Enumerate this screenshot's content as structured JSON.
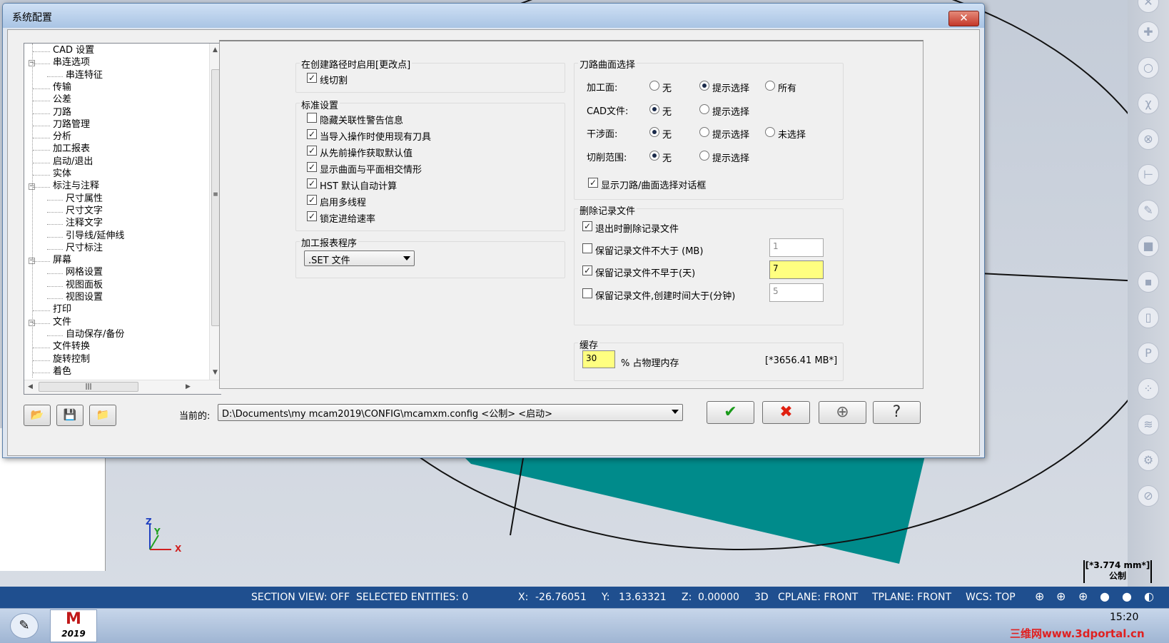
{
  "dialog": {
    "title": "系统配置",
    "close_label": "✕"
  },
  "tree": {
    "items": [
      {
        "label": "CAD 设置",
        "level": 2
      },
      {
        "label": "串连选项",
        "level": 1,
        "expander": "−"
      },
      {
        "label": "串连特征",
        "level": 3
      },
      {
        "label": "传输",
        "level": 2
      },
      {
        "label": "公差",
        "level": 2
      },
      {
        "label": "刀路",
        "level": 2
      },
      {
        "label": "刀路管理",
        "level": 2
      },
      {
        "label": "分析",
        "level": 2
      },
      {
        "label": "加工报表",
        "level": 2
      },
      {
        "label": "启动/退出",
        "level": 2
      },
      {
        "label": "实体",
        "level": 2
      },
      {
        "label": "标注与注释",
        "level": 1,
        "expander": "−"
      },
      {
        "label": "尺寸属性",
        "level": 3
      },
      {
        "label": "尺寸文字",
        "level": 3
      },
      {
        "label": "注释文字",
        "level": 3
      },
      {
        "label": "引导线/延伸线",
        "level": 3
      },
      {
        "label": "尺寸标注",
        "level": 3
      },
      {
        "label": "屏幕",
        "level": 1,
        "expander": "−"
      },
      {
        "label": "网格设置",
        "level": 3
      },
      {
        "label": "视图面板",
        "level": 3
      },
      {
        "label": "视图设置",
        "level": 3
      },
      {
        "label": "打印",
        "level": 2
      },
      {
        "label": "文件",
        "level": 1,
        "expander": "−"
      },
      {
        "label": "自动保存/备份",
        "level": 3
      },
      {
        "label": "文件转换",
        "level": 2
      },
      {
        "label": "旋转控制",
        "level": 2
      },
      {
        "label": "着色",
        "level": 2
      }
    ],
    "vscroll_grip": "≡",
    "hscroll_grip": "|||"
  },
  "toolpath_change": {
    "title": "在创建路径时启用[更改点]",
    "items": [
      {
        "label": "线切割",
        "checked": true
      }
    ]
  },
  "standard": {
    "title": "标准设置",
    "items": [
      {
        "label": "隐藏关联性警告信息",
        "checked": false
      },
      {
        "label": "当导入操作时使用现有刀具",
        "checked": true
      },
      {
        "label": "从先前操作获取默认值",
        "checked": true
      },
      {
        "label": "显示曲面与平面相交情形",
        "checked": true
      },
      {
        "label": "HST 默认自动计算",
        "checked": true
      },
      {
        "label": "启用多线程",
        "checked": true
      },
      {
        "label": "锁定进给速率",
        "checked": true
      }
    ]
  },
  "report": {
    "title": "加工报表程序",
    "selected": ".SET 文件"
  },
  "surface_select": {
    "title": "刀路曲面选择",
    "rows": [
      {
        "label": "加工面:",
        "options": [
          {
            "label": "无",
            "on": false
          },
          {
            "label": "提示选择",
            "on": true
          },
          {
            "label": "所有",
            "on": false
          }
        ]
      },
      {
        "label": "CAD文件:",
        "options": [
          {
            "label": "无",
            "on": true
          },
          {
            "label": "提示选择",
            "on": false
          }
        ]
      },
      {
        "label": "干涉面:",
        "options": [
          {
            "label": "无",
            "on": true
          },
          {
            "label": "提示选择",
            "on": false
          },
          {
            "label": "未选择",
            "on": false
          }
        ]
      },
      {
        "label": "切削范围:",
        "options": [
          {
            "label": "无",
            "on": true
          },
          {
            "label": "提示选择",
            "on": false
          }
        ]
      }
    ],
    "show_dialog": {
      "label": "显示刀路/曲面选择对话框",
      "checked": true
    }
  },
  "delete_log": {
    "title": "删除记录文件",
    "items": [
      {
        "label": "退出时删除记录文件",
        "checked": true
      },
      {
        "label": "保留记录文件不大于 (MB)",
        "checked": false,
        "value": "1",
        "highlight": false
      },
      {
        "label": "保留记录文件不早于(天)",
        "checked": true,
        "value": "7",
        "highlight": true
      },
      {
        "label": "保留记录文件,创建时间大于(分钟)",
        "checked": false,
        "value": "5",
        "highlight": false
      }
    ]
  },
  "cache": {
    "title": "缓存",
    "value": "30",
    "unit_label": "% 占物理内存",
    "total": "[*3656.41 MB*]"
  },
  "current": {
    "label": "当前的:",
    "path": "D:\\Documents\\my mcam2019\\CONFIG\\mcamxm.config <公制> <启动>"
  },
  "buttons": {
    "ok": "✔",
    "cancel": "✖",
    "add": "⊕",
    "help": "?"
  },
  "status_bar": {
    "section_view": "SECTION VIEW: OFF",
    "selected": "SELECTED ENTITIES: 0",
    "x_label": "X:",
    "x_value": "-26.76051",
    "y_label": "Y:",
    "y_value": "13.63321",
    "z_label": "Z:",
    "z_value": "0.00000",
    "mode": "3D",
    "cplane": "CPLANE: FRONT",
    "tplane": "TPLANE: FRONT",
    "wcs": "WCS: TOP"
  },
  "viewport": {
    "scale_value": "[*3.774 mm*]",
    "scale_unit": "公制",
    "axis_x": "X",
    "axis_y": "Y",
    "axis_z": "Z"
  },
  "taskbar": {
    "app_label": "2019",
    "clock": "15:20",
    "watermark": "三维网www.3dportal.cn"
  },
  "colors": {
    "accent_teal": "#008b8b",
    "highlight_yellow": "#ffff80",
    "status_bar": "#1f4f8f"
  }
}
